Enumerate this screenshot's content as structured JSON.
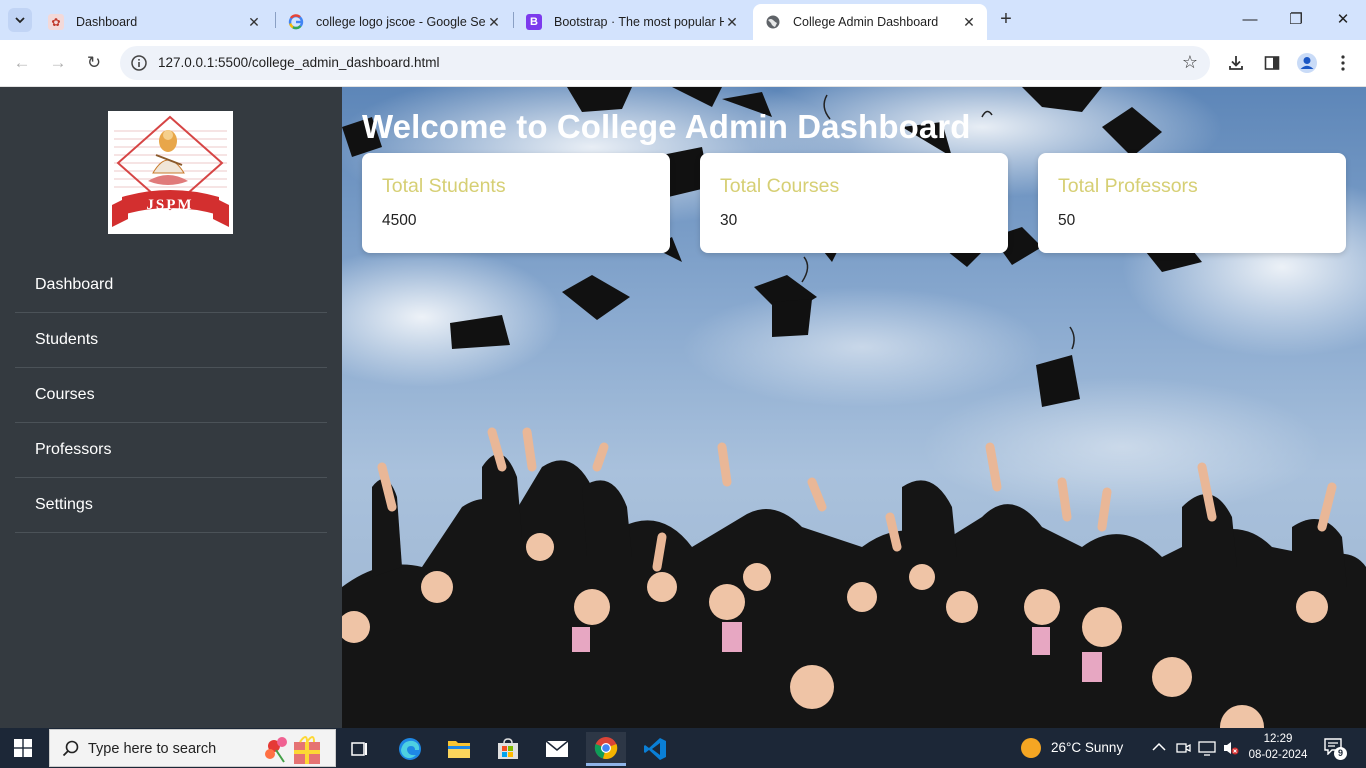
{
  "browser": {
    "tabs": [
      {
        "title": "Dashboard",
        "active": false
      },
      {
        "title": "college logo jscoe - Google Sea",
        "active": false
      },
      {
        "title": "Bootstrap · The most popular H",
        "active": false
      },
      {
        "title": "College Admin Dashboard",
        "active": true
      }
    ],
    "url": "127.0.0.1:5500/college_admin_dashboard.html"
  },
  "sidebar": {
    "logo_text": "JSPM",
    "items": [
      {
        "label": "Dashboard"
      },
      {
        "label": "Students"
      },
      {
        "label": "Courses"
      },
      {
        "label": "Professors"
      },
      {
        "label": "Settings"
      }
    ]
  },
  "main": {
    "welcome": "Welcome to College Admin Dashboard",
    "cards": [
      {
        "title": "Total Students",
        "value": "4500"
      },
      {
        "title": "Total Courses",
        "value": "30"
      },
      {
        "title": "Total Professors",
        "value": "50"
      }
    ]
  },
  "taskbar": {
    "search_placeholder": "Type here to search",
    "weather": "26°C  Sunny",
    "time": "12:29",
    "date": "08-02-2024",
    "notifications": "9"
  },
  "colors": {
    "sidebar_bg": "#343a40",
    "card_title": "#d6cf74",
    "tabbar_bg": "#d3e3fd",
    "taskbar_bg": "#1c2737"
  }
}
